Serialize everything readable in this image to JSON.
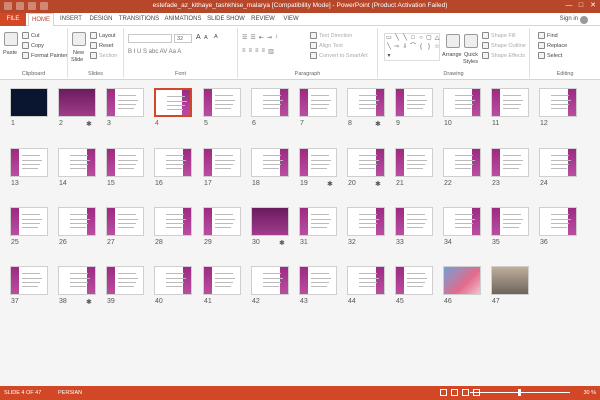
{
  "titlebar": {
    "title": "estefade_az_kithaye_tashkhise_malarya [Compatibility Mode] - PowerPoint (Product Activation Failed)",
    "min": "—",
    "max": "□",
    "close": "✕"
  },
  "tabs": [
    "FILE",
    "HOME",
    "INSERT",
    "DESIGN",
    "TRANSITIONS",
    "ANIMATIONS",
    "SLIDE SHOW",
    "REVIEW",
    "VIEW"
  ],
  "signin": "Sign in",
  "ribbon": {
    "clipboard": {
      "label": "Clipboard",
      "paste": "Paste",
      "cut": "Cut",
      "copy": "Copy",
      "format_painter": "Format Painter"
    },
    "slides": {
      "label": "Slides",
      "new_slide_1": "New",
      "new_slide_2": "Slide",
      "layout": "Layout",
      "reset": "Reset",
      "section": "Section"
    },
    "font": {
      "label": "Font",
      "size": "32",
      "clear": "A",
      "grow": "A",
      "shrink": "A",
      "styles": "B  I  U  S  abc  AV  Aa  A"
    },
    "paragraph": {
      "label": "Paragraph",
      "text_direction": "Text Direction",
      "align_text": "Align Text",
      "smartart": "Convert to SmartArt"
    },
    "drawing": {
      "label": "Drawing",
      "arrange": "Arrange",
      "quick_styles_1": "Quick",
      "quick_styles_2": "Styles",
      "shape_fill": "Shape Fill",
      "shape_outline": "Shape Outline",
      "shape_effects": "Shape Effects"
    },
    "editing": {
      "label": "Editing",
      "find": "Find",
      "replace": "Replace",
      "select": "Select"
    }
  },
  "slides": [
    {
      "n": "1",
      "t": "dark"
    },
    {
      "n": "2",
      "t": "purple",
      "star": true
    },
    {
      "n": "3",
      "t": "std"
    },
    {
      "n": "4",
      "t": "std",
      "sel": true
    },
    {
      "n": "5",
      "t": "std"
    },
    {
      "n": "6",
      "t": "std"
    },
    {
      "n": "7",
      "t": "std"
    },
    {
      "n": "8",
      "t": "std",
      "star": true
    },
    {
      "n": "9",
      "t": "std"
    },
    {
      "n": "10",
      "t": "std"
    },
    {
      "n": "11",
      "t": "std"
    },
    {
      "n": "12",
      "t": "std"
    },
    {
      "n": "13",
      "t": "std"
    },
    {
      "n": "14",
      "t": "std"
    },
    {
      "n": "15",
      "t": "std"
    },
    {
      "n": "16",
      "t": "std"
    },
    {
      "n": "17",
      "t": "std"
    },
    {
      "n": "18",
      "t": "std"
    },
    {
      "n": "19",
      "t": "std",
      "star": true
    },
    {
      "n": "20",
      "t": "std",
      "star": true
    },
    {
      "n": "21",
      "t": "std"
    },
    {
      "n": "22",
      "t": "std"
    },
    {
      "n": "23",
      "t": "std"
    },
    {
      "n": "24",
      "t": "std"
    },
    {
      "n": "25",
      "t": "std"
    },
    {
      "n": "26",
      "t": "std"
    },
    {
      "n": "27",
      "t": "std"
    },
    {
      "n": "28",
      "t": "std"
    },
    {
      "n": "29",
      "t": "std"
    },
    {
      "n": "30",
      "t": "purple",
      "star": true
    },
    {
      "n": "31",
      "t": "std"
    },
    {
      "n": "32",
      "t": "std"
    },
    {
      "n": "33",
      "t": "std"
    },
    {
      "n": "34",
      "t": "std"
    },
    {
      "n": "35",
      "t": "std"
    },
    {
      "n": "36",
      "t": "std"
    },
    {
      "n": "37",
      "t": "std"
    },
    {
      "n": "38",
      "t": "std",
      "star": true
    },
    {
      "n": "39",
      "t": "std"
    },
    {
      "n": "40",
      "t": "std"
    },
    {
      "n": "41",
      "t": "std"
    },
    {
      "n": "42",
      "t": "std"
    },
    {
      "n": "43",
      "t": "std"
    },
    {
      "n": "44",
      "t": "std"
    },
    {
      "n": "45",
      "t": "std"
    },
    {
      "n": "46",
      "t": "photo1"
    },
    {
      "n": "47",
      "t": "photo2"
    }
  ],
  "status": {
    "slide": "SLIDE 4 OF 47",
    "language": "PERSIAN",
    "zoom": "30 %"
  },
  "colors": {
    "accent": "#d24726",
    "title": "#b7472a",
    "magenta": "#9c2a83"
  }
}
